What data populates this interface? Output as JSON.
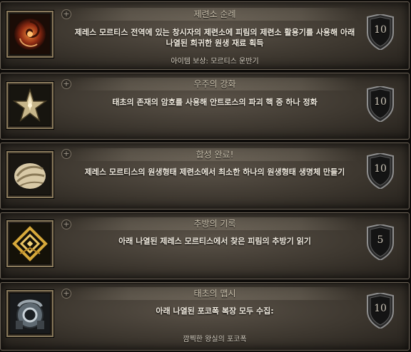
{
  "achievements": [
    {
      "title": "제련소 순례",
      "description": "제레스 모르티스 전역에 있는 창시자의 제련소에 피림의 제련소 활용기를 사용해 아래 나열된 희귀한 원생 재료 획득",
      "reward": "아이템 보상: 모르티스 운반기",
      "points": "10",
      "icon": "swirl-orb-icon"
    },
    {
      "title": "우주의 강화",
      "description": "태초의 존재의 암호를 사용해 안트로스의 파괴 핵 중 하나 정화",
      "reward": "",
      "points": "10",
      "icon": "star-crystal-icon"
    },
    {
      "title": "합성 완료!",
      "description": "제레스 모르티스의 원생형태 제련소에서 최소한 하나의 원생형태 생명체 만들기",
      "reward": "",
      "points": "10",
      "icon": "shell-creature-icon"
    },
    {
      "title": "추방의 기록",
      "description": "아래 나열된 제레스 모르티스에서 찾은 피림의 추방기 읽기",
      "reward": "",
      "points": "5",
      "icon": "golden-glyph-icon"
    },
    {
      "title": "태초의 맵시",
      "description": "아래 나열된 포코폭 복장 모두 수집:",
      "reward": "깜찍한 왕실의 포코폭",
      "points": "10",
      "icon": "pocopoc-icon"
    }
  ]
}
